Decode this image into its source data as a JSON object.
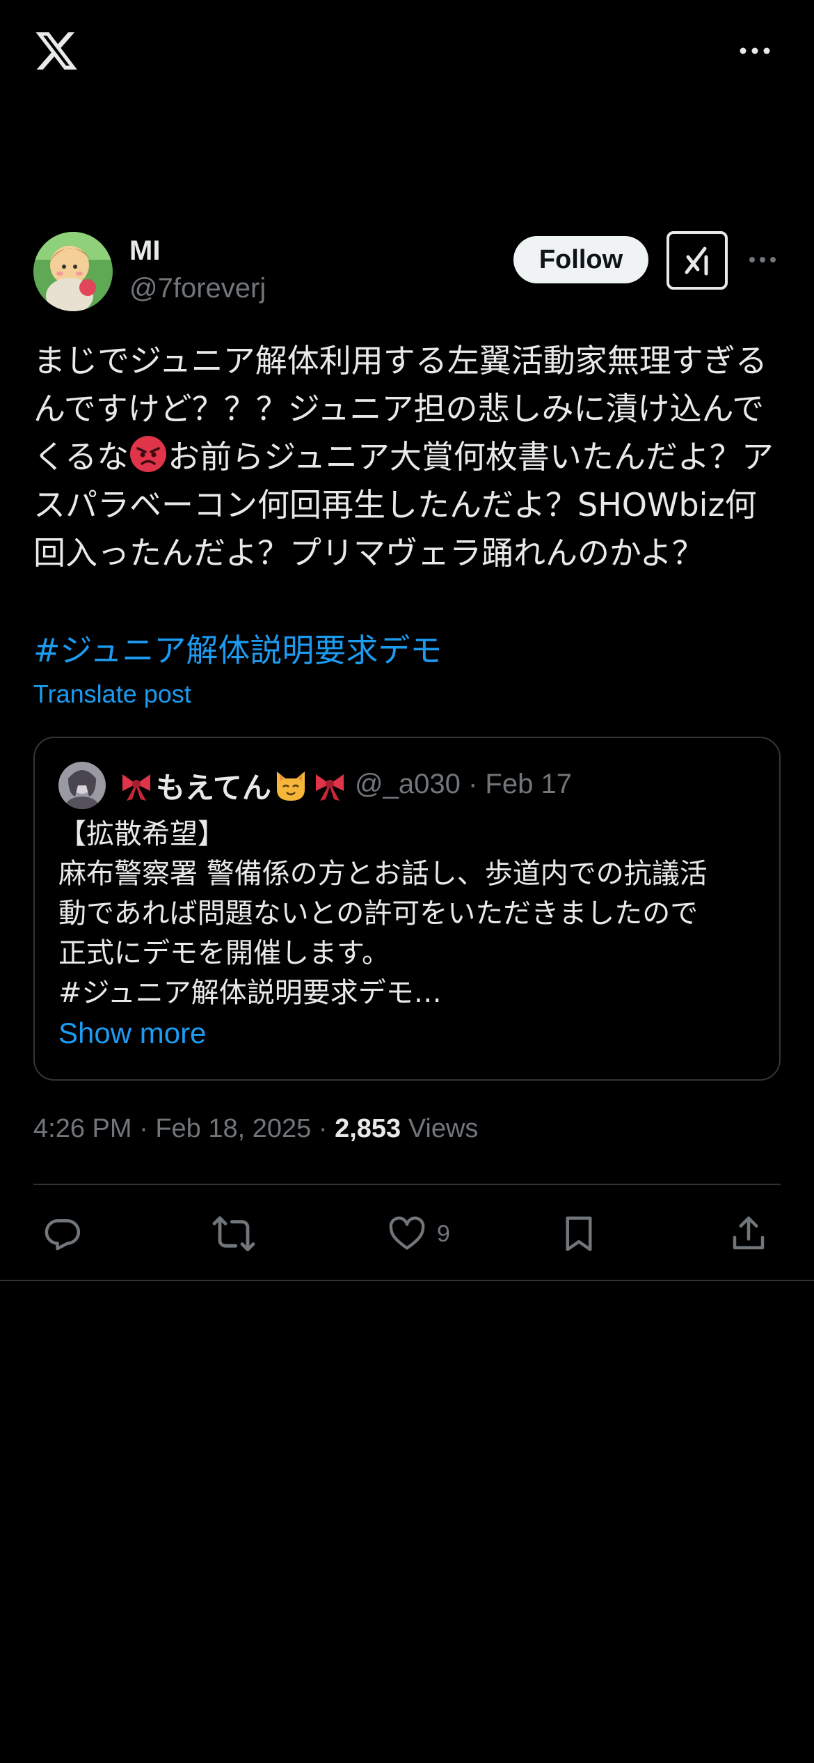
{
  "header": {
    "logo_icon": "x-logo-icon",
    "more_icon": "more-horizontal-icon"
  },
  "post": {
    "author": {
      "name": "MI",
      "handle": "@7foreverj"
    },
    "follow_label": "Follow",
    "grok_icon": "grok-icon",
    "text_part1": "まじでジュニア解体利用する左翼活動家無理すぎるんですけど？？？ジュニア担の悲しみに漬け込んでくるな",
    "text_emoji": "angry-face-emoji",
    "text_part2": "お前らジュニア大賞何枚書いたんだよ？アスパラベーコン何回再生したんだよ？SHOWbiz何回入ったんだよ？プリマヴェラ踊れんのかよ？",
    "hashtag": "#ジュニア解体説明要求デモ",
    "translate_label": "Translate post",
    "quote": {
      "name_text": "もえてん",
      "name_emojis": [
        "ribbon-emoji",
        "cat-face-emoji",
        "ribbon-emoji"
      ],
      "handle": "@_a030",
      "date": "Feb 17",
      "lines": [
        "【拡散希望】",
        "麻布警察署 警備係の方とお話し、歩道内での抗議活",
        "動であれば問題ないとの許可をいただきましたので",
        "正式にデモを開催します。",
        "#ジュニア解体説明要求デモ…"
      ],
      "show_more": "Show more"
    },
    "time": "4:26 PM",
    "date": "Feb 18, 2025",
    "views_count": "2,853",
    "views_label": "Views",
    "actions": {
      "like_count": "9"
    }
  },
  "colors": {
    "background": "#000000",
    "text": "#e7e9ea",
    "muted": "#71767b",
    "link": "#1d9bf0",
    "border": "#333639"
  }
}
